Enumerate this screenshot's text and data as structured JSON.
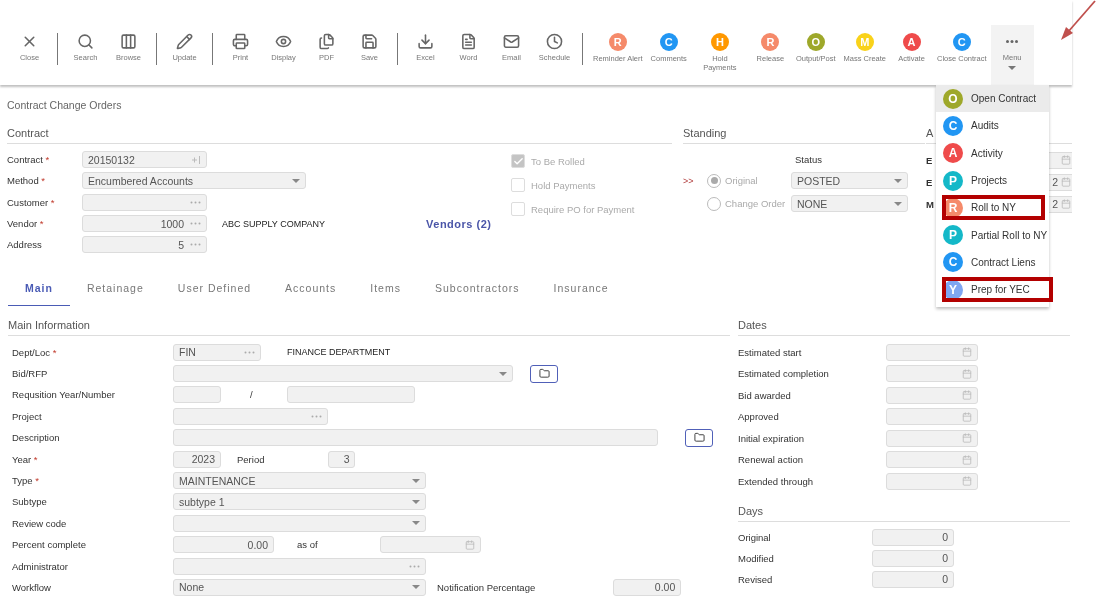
{
  "toolbar": {
    "items": [
      {
        "kind": "glyph",
        "label": "Close",
        "divider_after": true
      },
      {
        "kind": "glyph",
        "label": "Search",
        "divider_after": false
      },
      {
        "kind": "glyph",
        "label": "Browse",
        "divider_after": true
      },
      {
        "kind": "glyph",
        "label": "Update",
        "divider_after": true
      },
      {
        "kind": "glyph",
        "label": "Print",
        "divider_after": false
      },
      {
        "kind": "glyph",
        "label": "Display",
        "divider_after": false
      },
      {
        "kind": "glyph",
        "label": "PDF",
        "divider_after": false
      },
      {
        "kind": "glyph",
        "label": "Save",
        "divider_after": true
      },
      {
        "kind": "glyph",
        "label": "Excel",
        "divider_after": false
      },
      {
        "kind": "glyph",
        "label": "Word",
        "divider_after": false
      },
      {
        "kind": "glyph",
        "label": "Email",
        "divider_after": false
      },
      {
        "kind": "glyph",
        "label": "Schedule",
        "divider_after": true
      },
      {
        "kind": "letter",
        "letter": "R",
        "color": "#f58a6a",
        "label": "Reminder Alert",
        "divider_after": false
      },
      {
        "kind": "letter",
        "letter": "C",
        "color": "#2196f3",
        "label": "Comments",
        "divider_after": false
      },
      {
        "kind": "letter",
        "letter": "H",
        "color": "#ff9800",
        "label": "Hold Payments",
        "divider_after": false
      },
      {
        "kind": "letter",
        "letter": "R",
        "color": "#f58a6a",
        "label": "Release",
        "divider_after": false
      },
      {
        "kind": "letter",
        "letter": "O",
        "color": "#9ea82a",
        "label": "Output/Post",
        "divider_after": false
      },
      {
        "kind": "letter",
        "letter": "M",
        "color": "#f9d21a",
        "label": "Mass Create",
        "divider_after": false
      },
      {
        "kind": "letter",
        "letter": "A",
        "color": "#ef4b4b",
        "label": "Activate",
        "divider_after": false
      },
      {
        "kind": "letter",
        "letter": "C",
        "color": "#2196f3",
        "label": "Close Contract",
        "divider_after": false
      }
    ]
  },
  "menu": {
    "label": "Menu",
    "open": true,
    "items": [
      {
        "letter": "O",
        "color": "#9ea82a",
        "label": "Open Contract",
        "selected": true,
        "highlighted": false
      },
      {
        "letter": "C",
        "color": "#2196f3",
        "label": "Audits",
        "selected": false,
        "highlighted": false
      },
      {
        "letter": "A",
        "color": "#ef4b4b",
        "label": "Activity",
        "selected": false,
        "highlighted": false
      },
      {
        "letter": "P",
        "color": "#14b8c8",
        "label": "Projects",
        "selected": false,
        "highlighted": false
      },
      {
        "letter": "R",
        "color": "#f58a6a",
        "label": "Roll to NY",
        "selected": false,
        "highlighted": true
      },
      {
        "letter": "P",
        "color": "#14b8c8",
        "label": "Partial Roll to NY",
        "selected": false,
        "highlighted": false
      },
      {
        "letter": "C",
        "color": "#2196f3",
        "label": "Contract Liens",
        "selected": false,
        "highlighted": false
      },
      {
        "letter": "Y",
        "color": "#7fa6f2",
        "label": "Prep for YEC",
        "selected": false,
        "highlighted": true
      }
    ]
  },
  "annotation_arrow": true,
  "page_title": "Contract Change Orders",
  "contract": {
    "title": "Contract",
    "fields": [
      {
        "kind": "number",
        "label": "Contract",
        "required_mark": "*",
        "value": "20150132"
      },
      {
        "kind": "select",
        "label": "Method",
        "required_mark": "*",
        "value": "Encumbered Accounts"
      },
      {
        "kind": "lookup",
        "label": "Customer",
        "required_mark": "*"
      },
      {
        "kind": "lookup",
        "label": "Vendor",
        "required_mark": "*",
        "value": "1000",
        "note": "ABC SUPPLY COMPANY",
        "link": "Vendors (2)"
      },
      {
        "kind": "lookup",
        "label": "Address",
        "value": "5"
      }
    ],
    "checkboxes": [
      {
        "label": "To Be Rolled",
        "checked": true,
        "disabled": true
      },
      {
        "label": "Hold Payments",
        "checked": false,
        "disabled": true
      },
      {
        "label": "Require PO for Payment",
        "checked": false,
        "disabled": true
      }
    ]
  },
  "standing": {
    "title": "Standing",
    "status_header": "Status",
    "options": [
      {
        "marker": ">>",
        "label": "Original",
        "selected": true,
        "status": "POSTED"
      },
      {
        "label": "Change Order",
        "selected": false,
        "status": "NONE"
      }
    ]
  },
  "side_section": {
    "title": "A",
    "rows": [
      {
        "label": "E"
      },
      {
        "label": "E",
        "value": "2"
      },
      {
        "label": "M",
        "value": "2"
      }
    ]
  },
  "tabs": [
    {
      "label": "Main",
      "selected": true
    },
    {
      "label": "Retainage",
      "selected": false
    },
    {
      "label": "User Defined",
      "selected": false
    },
    {
      "label": "Accounts",
      "selected": false
    },
    {
      "label": "Items",
      "selected": false
    },
    {
      "label": "Subcontractors",
      "selected": false
    },
    {
      "label": "Insurance",
      "selected": false
    }
  ],
  "main_info": {
    "title": "Main Information",
    "rows": [
      {
        "kind": "code_lookup",
        "label": "Dept/Loc",
        "required_mark": "*",
        "value": "FIN",
        "note": "FINANCE DEPARTMENT"
      },
      {
        "kind": "select_folder",
        "label": "Bid/RFP"
      },
      {
        "kind": "pair",
        "label": "Requsition Year/Number",
        "separator": "/"
      },
      {
        "kind": "lookup",
        "label": "Project"
      },
      {
        "kind": "text_folder",
        "label": "Description"
      },
      {
        "kind": "year_period",
        "label": "Year",
        "required_mark": "*",
        "value": "2023",
        "label2": "Period",
        "value2": "3"
      },
      {
        "kind": "select",
        "label": "Type",
        "required_mark": "*",
        "value": "MAINTENANCE"
      },
      {
        "kind": "select",
        "label": "Subtype",
        "value": "subtype 1"
      },
      {
        "kind": "select",
        "label": "Review code"
      },
      {
        "kind": "percent_date",
        "label": "Percent complete",
        "value": "0.00",
        "label2": "as of"
      },
      {
        "kind": "wide_lookup",
        "label": "Administrator"
      },
      {
        "kind": "select_number",
        "label": "Workflow",
        "value": "None",
        "label2": "Notification Percentage",
        "value2": "0.00"
      }
    ]
  },
  "dates": {
    "title": "Dates",
    "rows": [
      {
        "label": "Estimated start"
      },
      {
        "label": "Estimated completion"
      },
      {
        "label": "Bid awarded"
      },
      {
        "label": "Approved"
      },
      {
        "label": "Initial expiration"
      },
      {
        "label": "Renewal action"
      },
      {
        "label": "Extended through"
      }
    ]
  },
  "days": {
    "title": "Days",
    "rows": [
      {
        "label": "Original",
        "value": "0"
      },
      {
        "label": "Modified",
        "value": "0"
      },
      {
        "label": "Revised",
        "value": "0"
      }
    ]
  }
}
